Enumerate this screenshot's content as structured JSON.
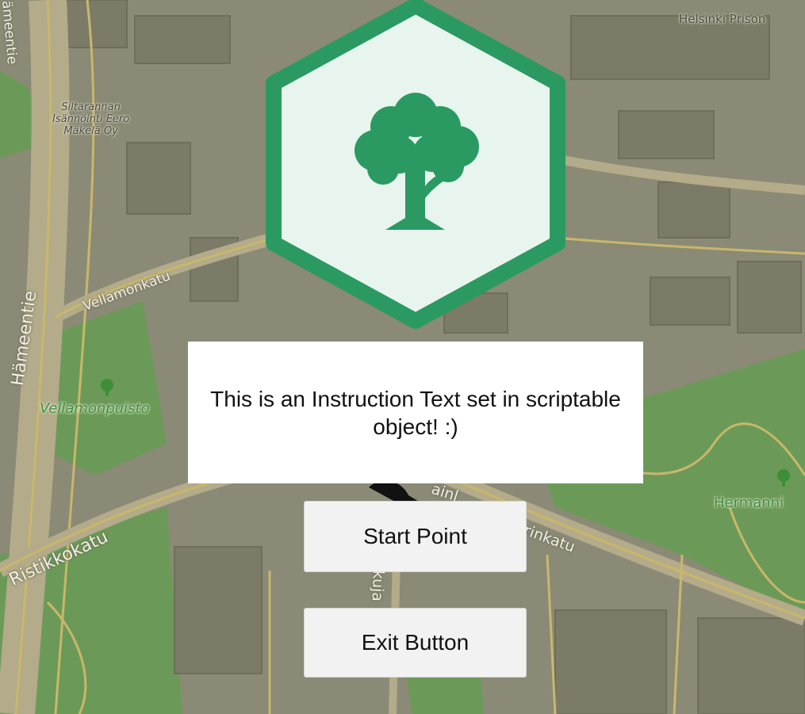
{
  "map": {
    "streets": [
      "Hämeentie",
      "Vellamonkatu",
      "Ristikkokatu",
      "Vellamonpuisto",
      "Hermanni",
      "Helsinki Prison",
      "rinkatu",
      "kuja",
      "ainl"
    ],
    "business_label": [
      "Siltarannan",
      "Isännöinti Eero",
      "Mäkelä Oy"
    ],
    "top_street": "ämeentie",
    "colors": {
      "base": "#8a8a76",
      "park": "#6b9a58",
      "road": "#c9b76a",
      "street_outline": "#b3ab8a"
    }
  },
  "logo": {
    "icon": "tree-icon",
    "fill": "#e8f4ee",
    "accent": "#2a9a62"
  },
  "instruction": {
    "text": "This is an Instruction Text set in scriptable object! :)"
  },
  "buttons": {
    "start_label": "Start Point",
    "exit_label": "Exit Button"
  }
}
